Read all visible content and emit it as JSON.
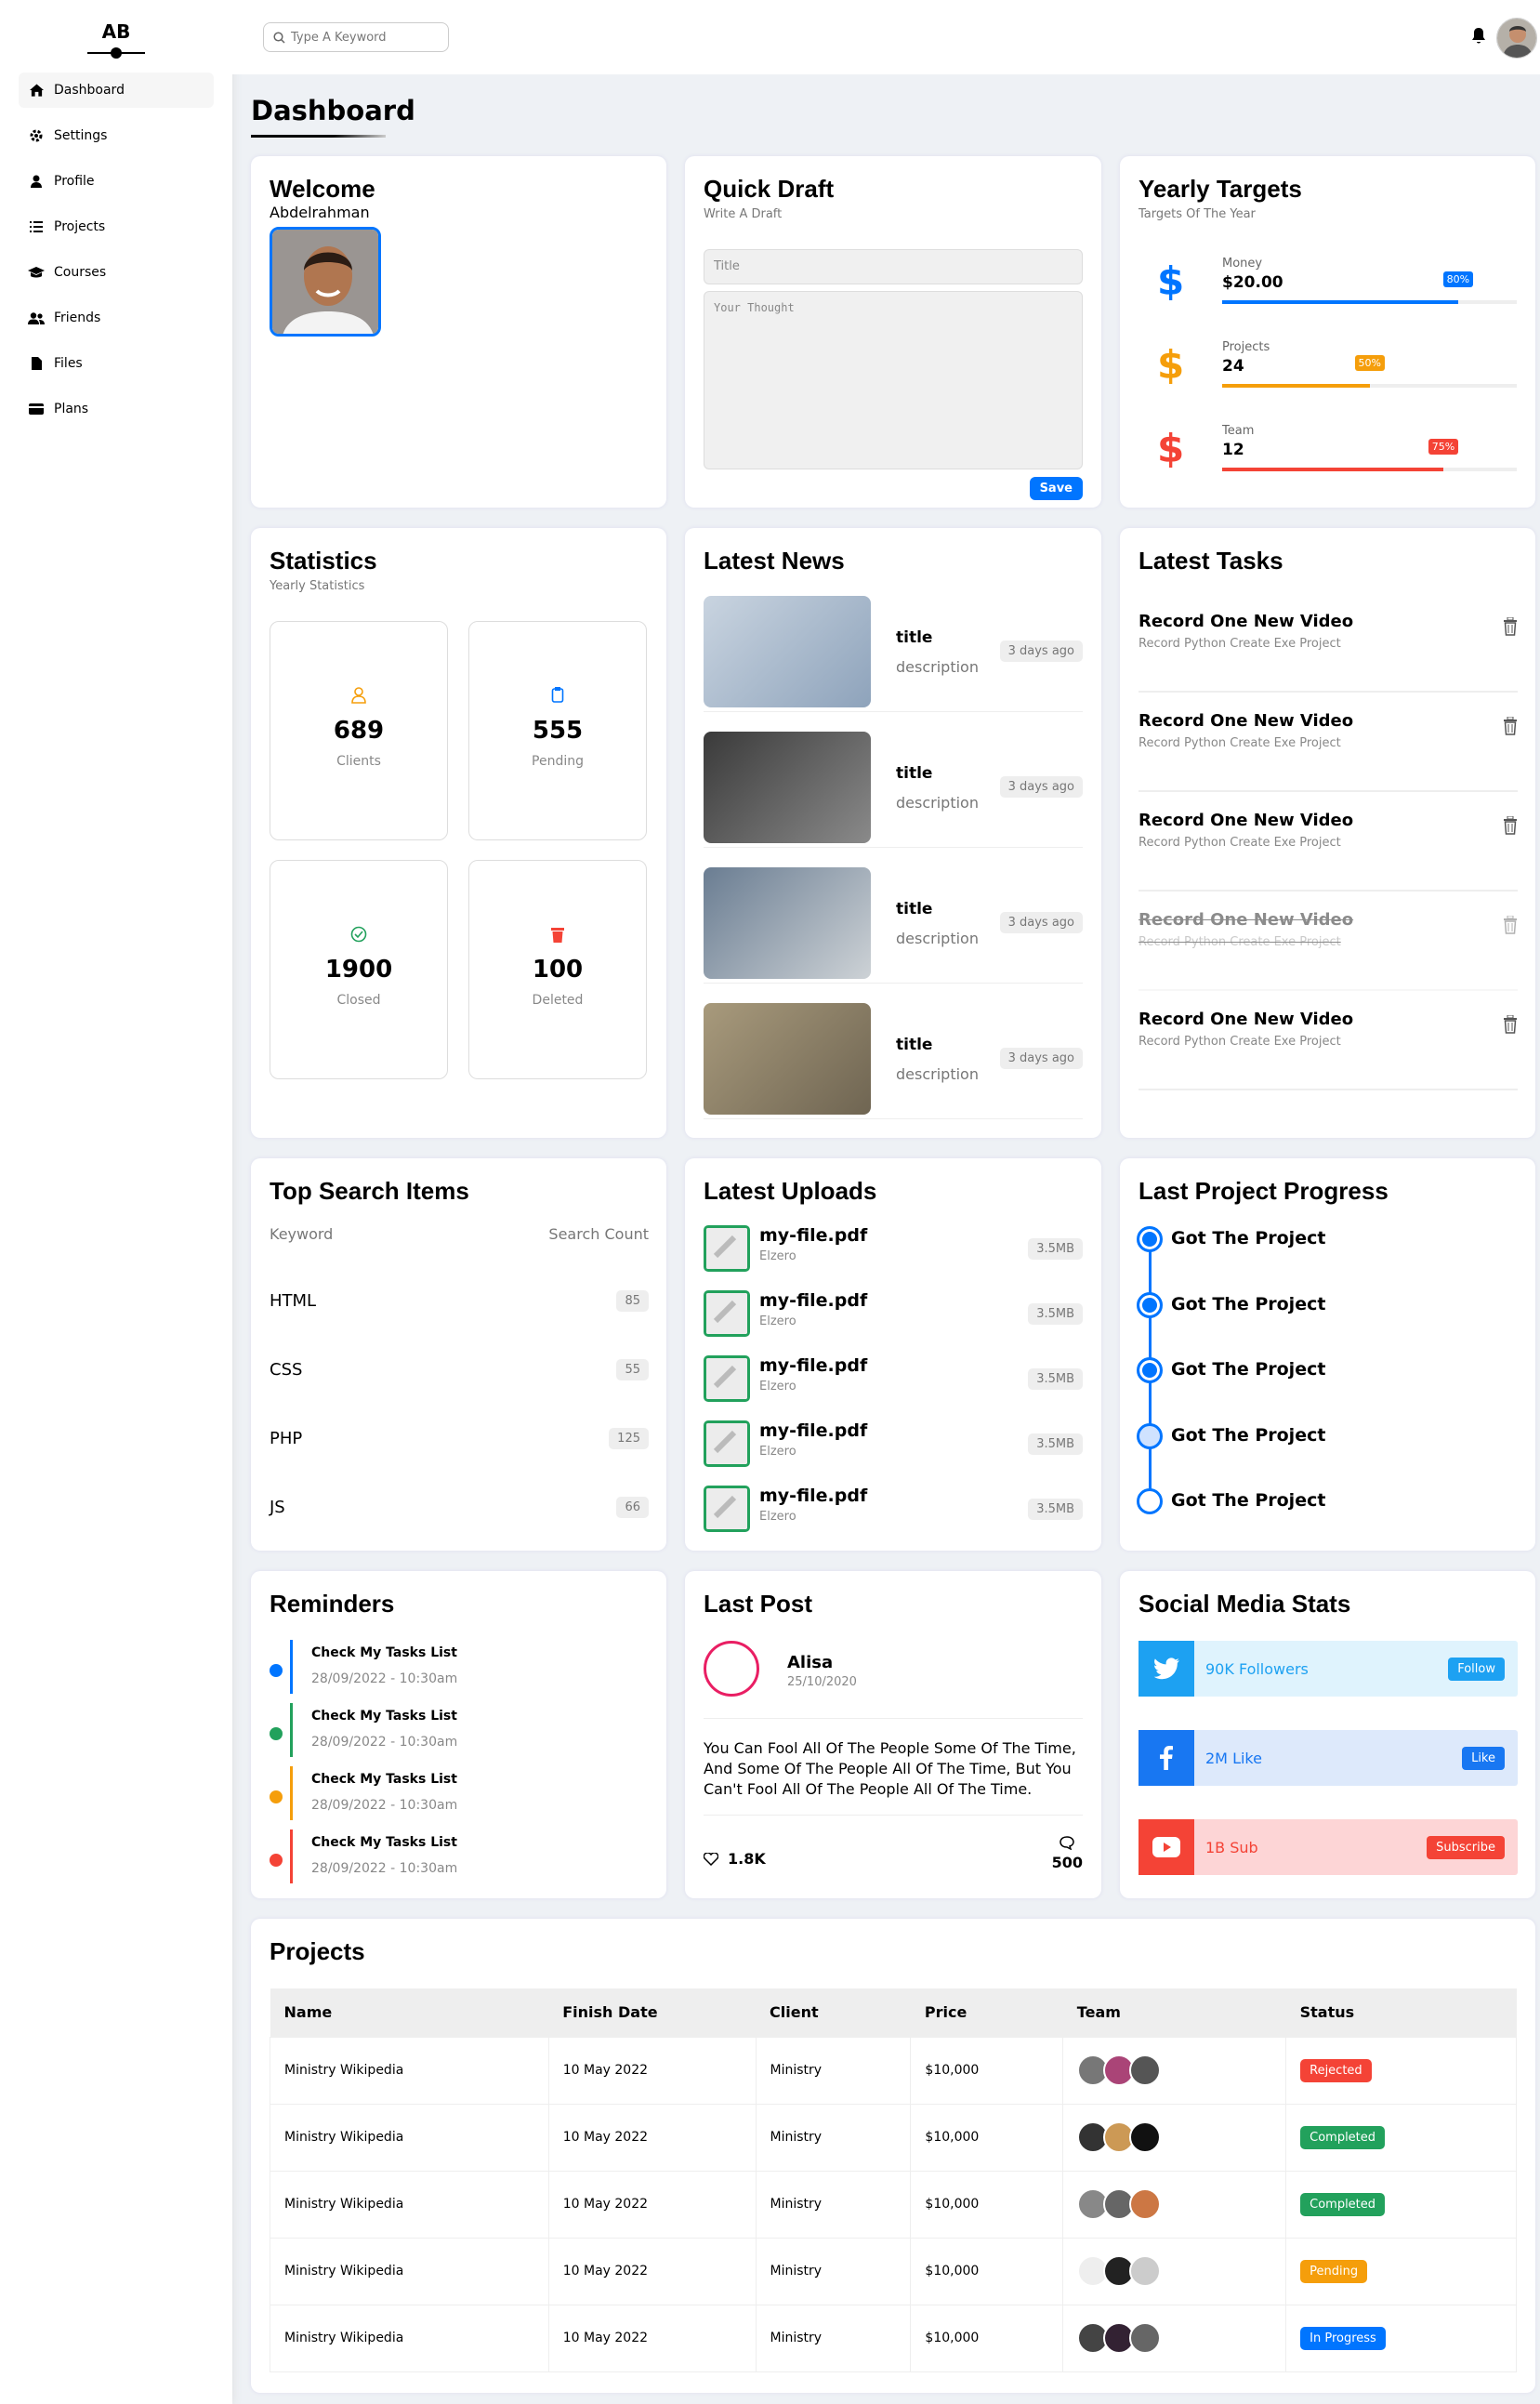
{
  "sidebar": {
    "logo": "AB",
    "items": [
      "Dashboard",
      "Settings",
      "Profile",
      "Projects",
      "Courses",
      "Friends",
      "Files",
      "Plans"
    ]
  },
  "header": {
    "search_placeholder": "Type A Keyword"
  },
  "page_title": "Dashboard",
  "welcome": {
    "title": "Welcome",
    "name": "Abdelrahman"
  },
  "draft": {
    "title": "Quick Draft",
    "subtitle": "Write A Draft",
    "title_placeholder": "Title",
    "body_placeholder": "Your Thought",
    "save": "Save"
  },
  "targets": {
    "title": "Yearly Targets",
    "subtitle": "Targets Of The Year",
    "items": [
      {
        "label": "Money",
        "value": "$20.00",
        "pct": "80%",
        "progress": 0.8,
        "color": "#0075ff"
      },
      {
        "label": "Projects",
        "value": "24",
        "pct": "50%",
        "progress": 0.5,
        "color": "#f59e0b"
      },
      {
        "label": "Team",
        "value": "12",
        "pct": "75%",
        "progress": 0.75,
        "color": "#f44336"
      }
    ]
  },
  "stats": {
    "title": "Statistics",
    "subtitle": "Yearly Statistics",
    "items": [
      {
        "num": "689",
        "label": "Clients"
      },
      {
        "num": "555",
        "label": "Pending"
      },
      {
        "num": "1900",
        "label": "Closed"
      },
      {
        "num": "100",
        "label": "Deleted"
      }
    ]
  },
  "news": {
    "title": "Latest News",
    "items": [
      {
        "title": "title",
        "desc": "description",
        "time": "3 days ago"
      },
      {
        "title": "title",
        "desc": "description",
        "time": "3 days ago"
      },
      {
        "title": "title",
        "desc": "description",
        "time": "3 days ago"
      },
      {
        "title": "title",
        "desc": "description",
        "time": "3 days ago"
      }
    ]
  },
  "tasks": {
    "title": "Latest Tasks",
    "items": [
      {
        "t": "Record One New Video",
        "d": "Record Python Create Exe Project"
      },
      {
        "t": "Record One New Video",
        "d": "Record Python Create Exe Project"
      },
      {
        "t": "Record One New Video",
        "d": "Record Python Create Exe Project"
      },
      {
        "t": "Record One New Video",
        "d": "Record Python Create Exe Project"
      },
      {
        "t": "Record One New Video",
        "d": "Record Python Create Exe Project"
      }
    ]
  },
  "top_search": {
    "title": "Top Search Items",
    "col1": "Keyword",
    "col2": "Search Count",
    "rows": [
      {
        "k": "HTML",
        "c": "85"
      },
      {
        "k": "CSS",
        "c": "55"
      },
      {
        "k": "PHP",
        "c": "125"
      },
      {
        "k": "JS",
        "c": "66"
      }
    ]
  },
  "uploads": {
    "title": "Latest Uploads",
    "items": [
      {
        "name": "my-file.pdf",
        "by": "Elzero",
        "size": "3.5MB"
      },
      {
        "name": "my-file.pdf",
        "by": "Elzero",
        "size": "3.5MB"
      },
      {
        "name": "my-file.pdf",
        "by": "Elzero",
        "size": "3.5MB"
      },
      {
        "name": "my-file.pdf",
        "by": "Elzero",
        "size": "3.5MB"
      },
      {
        "name": "my-file.pdf",
        "by": "Elzero",
        "size": "3.5MB"
      }
    ]
  },
  "progress": {
    "title": "Last Project Progress",
    "items": [
      "Got The Project",
      "Got The Project",
      "Got The Project",
      "Got The Project",
      "Got The Project"
    ]
  },
  "reminders": {
    "title": "Reminders",
    "items": [
      {
        "t": "Check My Tasks List",
        "d": "28/09/2022 - 10:30am",
        "color": "#0075ff"
      },
      {
        "t": "Check My Tasks List",
        "d": "28/09/2022 - 10:30am",
        "color": "#22a15c"
      },
      {
        "t": "Check My Tasks List",
        "d": "28/09/2022 - 10:30am",
        "color": "#f59e0b"
      },
      {
        "t": "Check My Tasks List",
        "d": "28/09/2022 - 10:30am",
        "color": "#f44336"
      }
    ]
  },
  "post": {
    "title": "Last Post",
    "author": "Alisa",
    "date": "25/10/2020",
    "body": "You Can Fool All Of The People Some Of The Time, And Some Of The People All Of The Time, But You Can't Fool All Of The People All Of The Time.",
    "likes": "1.8K",
    "comments": "500"
  },
  "social": {
    "title": "Social Media Stats",
    "items": [
      {
        "text": "90K Followers",
        "btn": "Follow",
        "icon": "twitter-icon",
        "color": "#1da1f2",
        "bg": "#dff3fd"
      },
      {
        "text": "2M Like",
        "btn": "Like",
        "icon": "facebook-icon",
        "color": "#1877f2",
        "bg": "#dde9fb"
      },
      {
        "text": "1B Sub",
        "btn": "Subscribe",
        "icon": "youtube-icon",
        "color": "#f44336",
        "bg": "#fdd5d6"
      }
    ]
  },
  "projects": {
    "title": "Projects",
    "headers": [
      "Name",
      "Finish Date",
      "Client",
      "Price",
      "Team",
      "Status"
    ],
    "rows": [
      {
        "name": "Ministry Wikipedia",
        "date": "10 May 2022",
        "client": "Ministry",
        "price": "$10,000",
        "status": "Rejected",
        "color": "#f44336"
      },
      {
        "name": "Ministry Wikipedia",
        "date": "10 May 2022",
        "client": "Ministry",
        "price": "$10,000",
        "status": "Completed",
        "color": "#22a15c"
      },
      {
        "name": "Ministry Wikipedia",
        "date": "10 May 2022",
        "client": "Ministry",
        "price": "$10,000",
        "status": "Completed",
        "color": "#22a15c"
      },
      {
        "name": "Ministry Wikipedia",
        "date": "10 May 2022",
        "client": "Ministry",
        "price": "$10,000",
        "status": "Pending",
        "color": "#f59e0b"
      },
      {
        "name": "Ministry Wikipedia",
        "date": "10 May 2022",
        "client": "Ministry",
        "price": "$10,000",
        "status": "In Progress",
        "color": "#0075ff"
      }
    ]
  }
}
